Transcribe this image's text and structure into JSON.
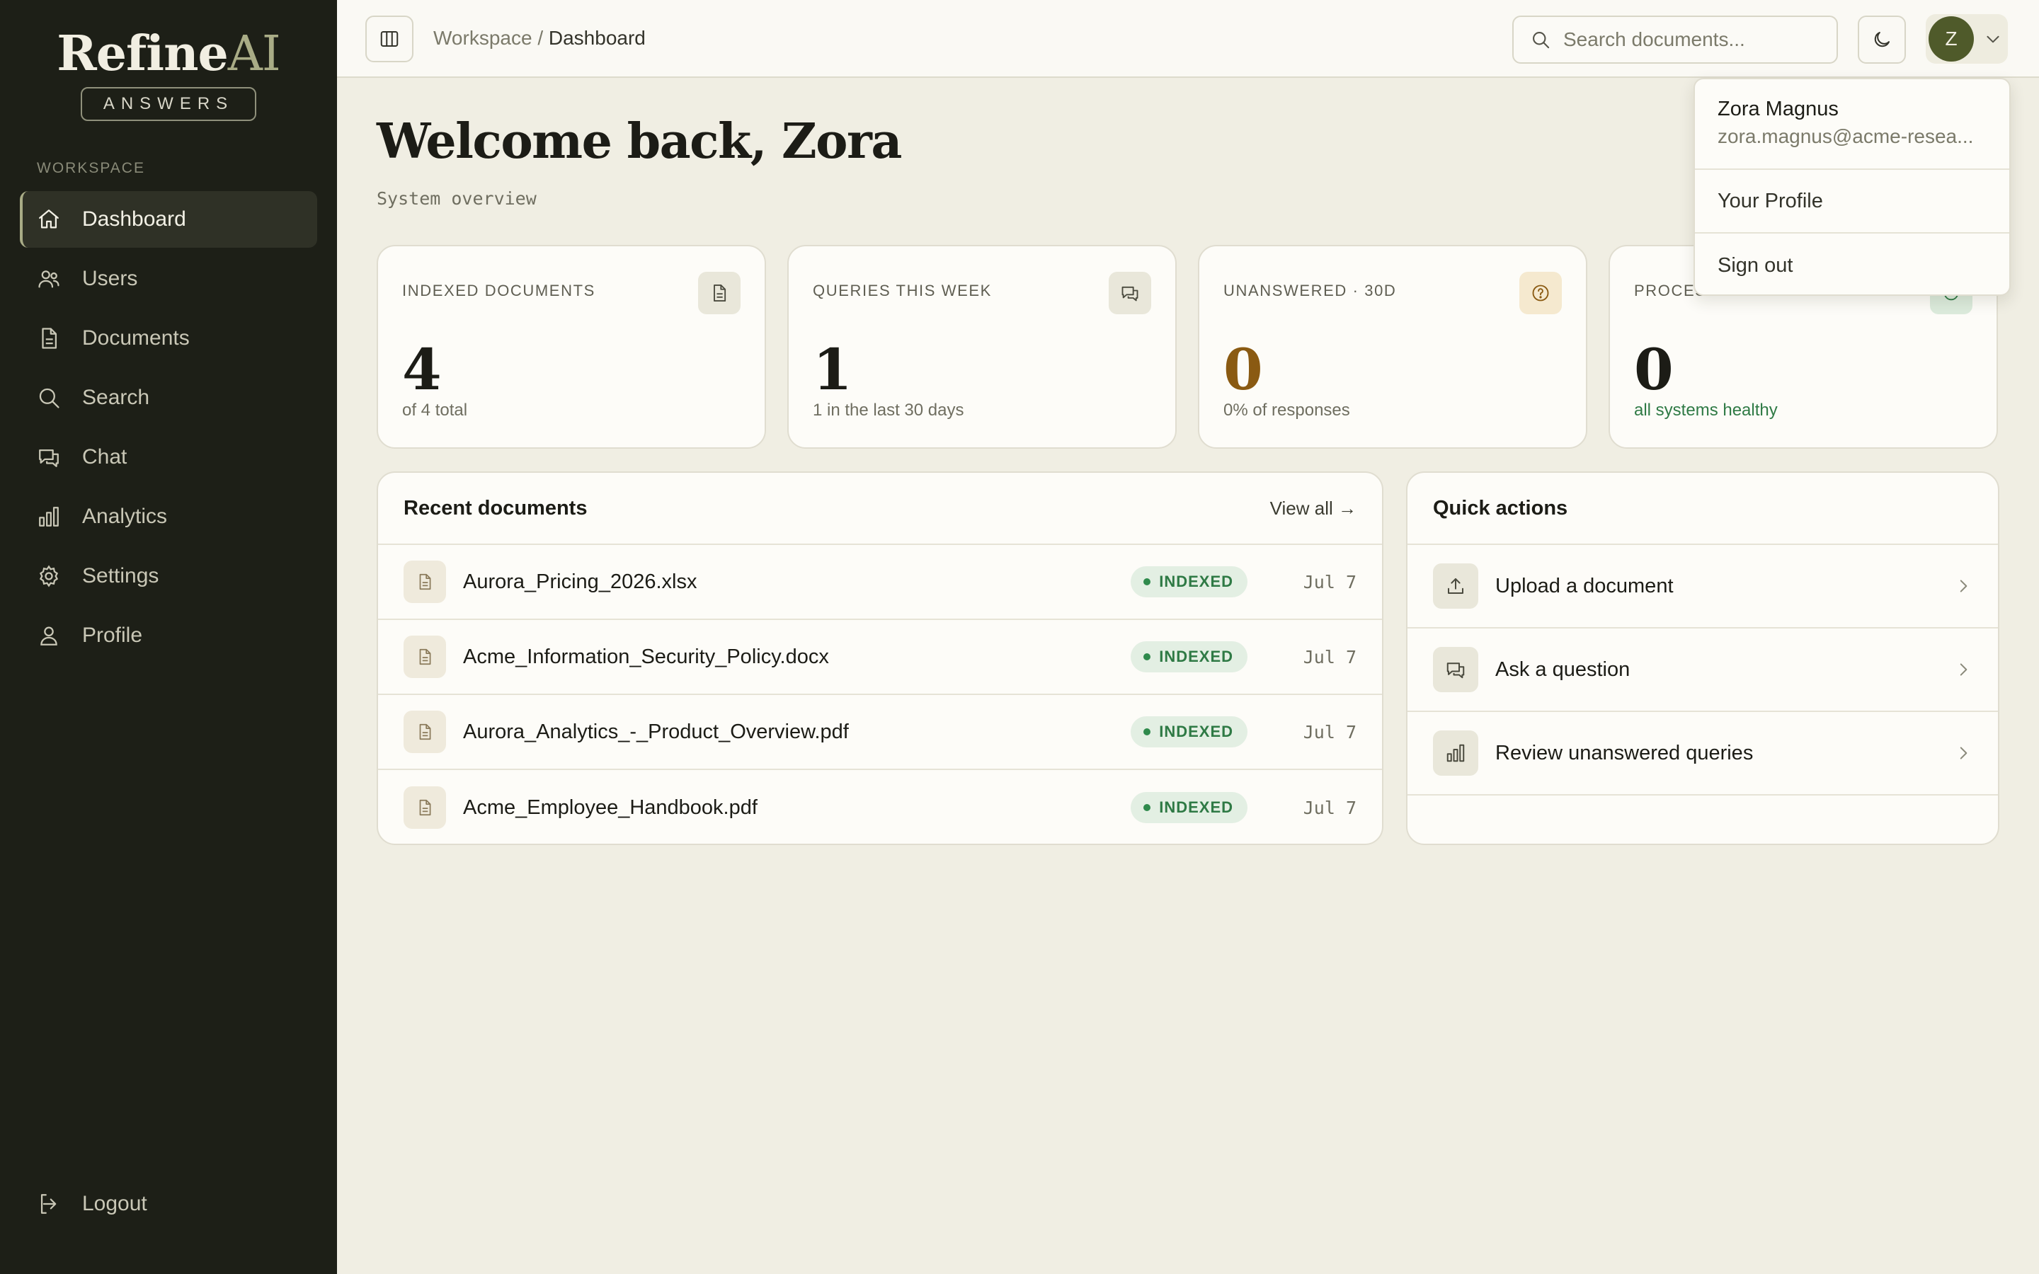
{
  "brand": {
    "name_main": "Refine",
    "name_accent": "AI",
    "tagline": "ANSWERS"
  },
  "sidebar": {
    "section_label": "WORKSPACE",
    "items": [
      {
        "label": "Dashboard",
        "icon": "home-icon",
        "active": true
      },
      {
        "label": "Users",
        "icon": "users-icon"
      },
      {
        "label": "Documents",
        "icon": "document-icon"
      },
      {
        "label": "Search",
        "icon": "search-icon"
      },
      {
        "label": "Chat",
        "icon": "chat-icon"
      },
      {
        "label": "Analytics",
        "icon": "bar-chart-icon"
      },
      {
        "label": "Settings",
        "icon": "gear-icon"
      },
      {
        "label": "Profile",
        "icon": "user-icon"
      }
    ],
    "logout_label": "Logout"
  },
  "header": {
    "breadcrumb_root": "Workspace",
    "breadcrumb_sep": "/",
    "breadcrumb_current": "Dashboard",
    "search_placeholder": "Search documents...",
    "avatar_initial": "Z"
  },
  "main": {
    "title": "Welcome back, Zora",
    "subtitle": "System overview",
    "stats": [
      {
        "label": "INDEXED DOCUMENTS",
        "value": "4",
        "sub": "of 4 total",
        "icon": "document-icon",
        "value_color": "#1c1c16",
        "sub_color": "#6f6e60",
        "icon_bg": "#e9e7da"
      },
      {
        "label": "QUERIES THIS WEEK",
        "value": "1",
        "sub": "1 in the last 30 days",
        "icon": "chat-icon",
        "value_color": "#1c1c16",
        "sub_color": "#6f6e60",
        "icon_bg": "#e9e7da"
      },
      {
        "label": "UNANSWERED · 30D",
        "value": "0",
        "sub": "0% of responses",
        "icon": "question-icon",
        "value_color": "#8a5a12",
        "sub_color": "#6f6e60",
        "icon_bg": "#f5e9cf"
      },
      {
        "label": "PROCES",
        "value": "0",
        "sub": "all systems healthy",
        "icon": "status-icon",
        "value_color": "#1c1c16",
        "sub_color": "#2f7a45",
        "icon_bg": "#dcebdc"
      }
    ],
    "recent": {
      "title": "Recent documents",
      "view_all": "View all →",
      "rows": [
        {
          "name": "Aurora_Pricing_2026.xlsx",
          "status": "INDEXED",
          "date": "Jul 7"
        },
        {
          "name": "Acme_Information_Security_Policy.docx",
          "status": "INDEXED",
          "date": "Jul 7"
        },
        {
          "name": "Aurora_Analytics_-_Product_Overview.pdf",
          "status": "INDEXED",
          "date": "Jul 7"
        },
        {
          "name": "Acme_Employee_Handbook.pdf",
          "status": "INDEXED",
          "date": "Jul 7"
        }
      ]
    },
    "quick_actions": {
      "title": "Quick actions",
      "items": [
        {
          "label": "Upload a document",
          "icon": "upload-icon"
        },
        {
          "label": "Ask a question",
          "icon": "chat-icon"
        },
        {
          "label": "Review unanswered queries",
          "icon": "bar-chart-icon"
        }
      ]
    }
  },
  "user_menu": {
    "name": "Zora Magnus",
    "email": "zora.magnus@acme-resea...",
    "items": [
      "Your Profile",
      "Sign out"
    ]
  },
  "colors": {
    "sidebar_bg": "#1d1f17",
    "page_bg": "#f0eee3",
    "accent": "#a9ac86",
    "success": "#2f7a45",
    "warning": "#8a5a12"
  }
}
